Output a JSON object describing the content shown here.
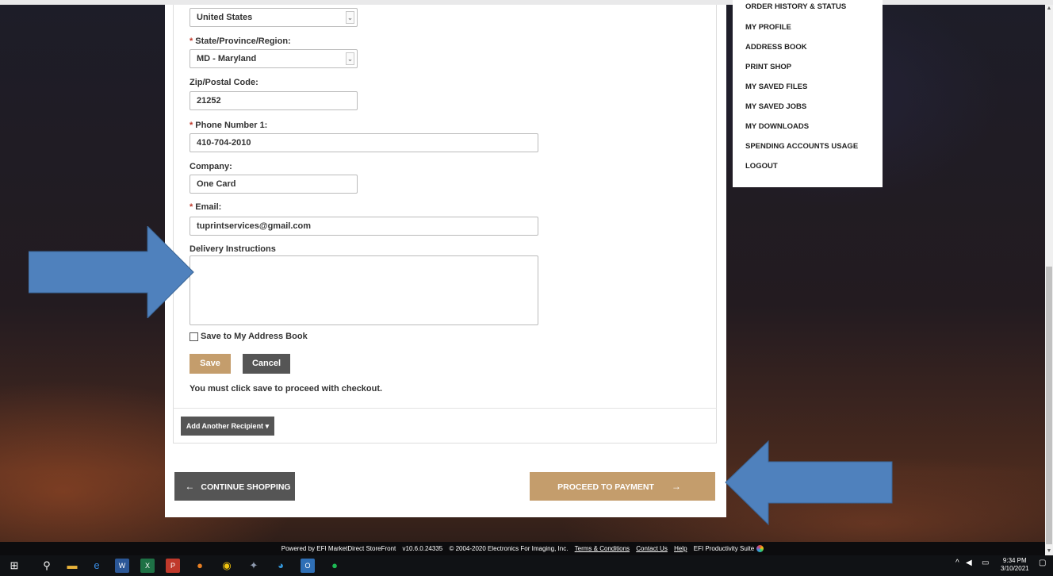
{
  "form": {
    "country_value": "United States",
    "state_label": "State/Province/Region:",
    "state_value": "MD - Maryland",
    "zip_label": "Zip/Postal Code:",
    "zip_value": "21252",
    "phone_label": "Phone Number 1:",
    "phone_value": "410-704-2010",
    "company_label": "Company:",
    "company_value": "One Card",
    "email_label": "Email:",
    "email_value": "tuprintservices@gmail.com",
    "delivery_label": "Delivery Instructions",
    "delivery_value": "",
    "required_mark": "*",
    "save_address_label": "Save to My Address Book",
    "save_label": "Save",
    "cancel_label": "Cancel",
    "note": "You must click save to proceed with checkout.",
    "add_recipient_label": "Add Another Recipient",
    "add_recipient_caret": "▾"
  },
  "nav_buttons": {
    "continue_label": "CONTINUE SHOPPING",
    "continue_icon": "←",
    "proceed_label": "PROCEED TO PAYMENT",
    "proceed_icon": "→"
  },
  "account_menu": {
    "items": [
      "ORDER HISTORY & STATUS",
      "MY PROFILE",
      "ADDRESS BOOK",
      "PRINT SHOP",
      "MY SAVED FILES",
      "MY SAVED JOBS",
      "MY DOWNLOADS",
      "SPENDING ACCOUNTS USAGE",
      "LOGOUT"
    ]
  },
  "footer": {
    "powered": "Powered by EFI MarketDirect StoreFront",
    "version": "v10.6.0.24335",
    "copyright": "© 2004-2020 Electronics For Imaging, Inc.",
    "links": [
      "Terms & Conditions",
      "Contact Us",
      "Help"
    ],
    "suite": "EFI Productivity Suite"
  },
  "taskbar": {
    "time": "9:34 PM",
    "date": "3/10/2021"
  },
  "colors": {
    "accent": "#c49d6c",
    "dark_button": "#555555",
    "arrow_blue": "#4f81bd"
  }
}
